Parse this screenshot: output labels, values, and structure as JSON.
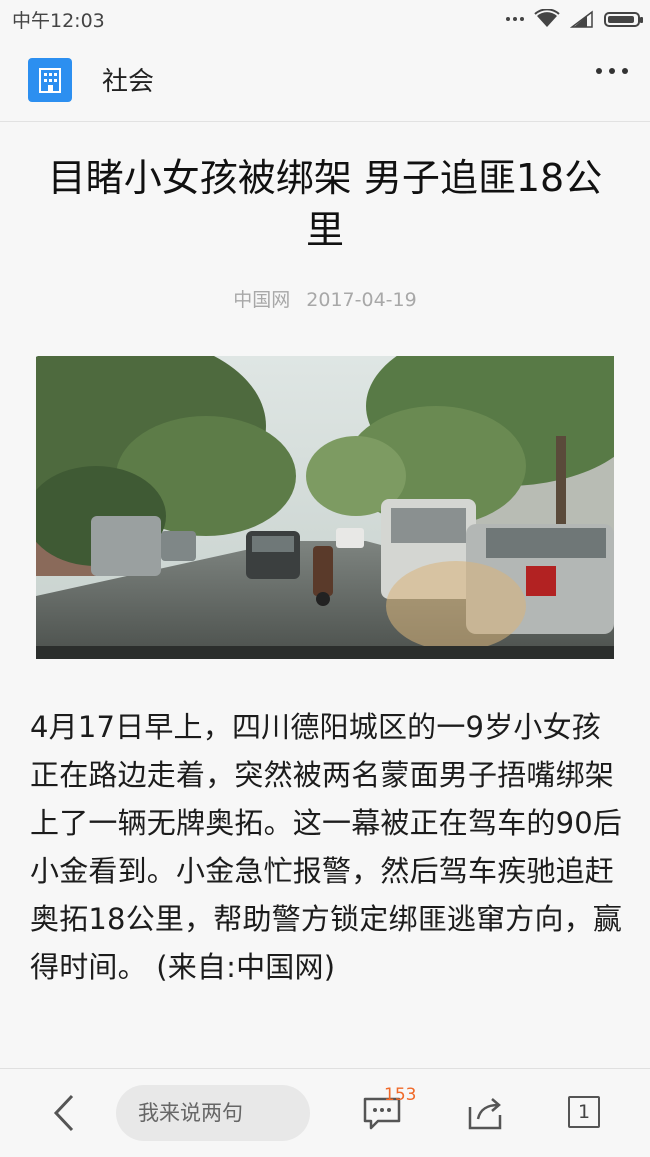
{
  "status_bar": {
    "time": "中午12:03",
    "icons": [
      "more-dots-icon",
      "wifi-icon",
      "signal-icon",
      "battery-icon"
    ]
  },
  "header": {
    "channel_icon": "building-icon",
    "channel_name": "社会",
    "menu_icon": "more-horizontal-icon"
  },
  "article": {
    "title": "目睹小女孩被绑架 男子追匪18公里",
    "source": "中国网",
    "date": "2017-04-19",
    "image": "dashcam street scene with cars, motorbike and trees",
    "body": "4月17日早上，四川德阳城区的一9岁小女孩正在路边走着，突然被两名蒙面男子捂嘴绑架上了一辆无牌奥拓。这一幕被正在驾车的90后小金看到。小金急忙报警，然后驾车疾驰追赶奥拓18公里，帮助警方锁定绑匪逃窜方向，赢得时间。 (来自:中国网)"
  },
  "bottom_bar": {
    "back_icon": "chevron-left-icon",
    "comment_placeholder": "我来说两句",
    "comments_icon": "comment-bubble-icon",
    "comment_count": "153",
    "share_icon": "share-icon",
    "page_count": "1"
  },
  "colors": {
    "accent": "#2c8ff0",
    "badge": "#f06a2a",
    "background": "#f7f7f7"
  }
}
